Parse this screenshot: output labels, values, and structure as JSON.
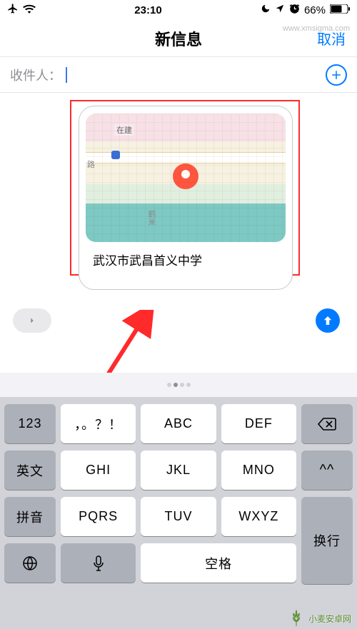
{
  "status": {
    "time": "23:10",
    "battery_pct": "66%"
  },
  "nav": {
    "title": "新信息",
    "cancel": "取消"
  },
  "recipient": {
    "label": "收件人：",
    "value": ""
  },
  "message": {
    "location_title": "武汉市武昌首义中学",
    "map_labels": {
      "under_construction": "在建",
      "road_suffix": "路",
      "vertical": "鹤米"
    }
  },
  "keyboard": {
    "rows": [
      [
        "123",
        "，。？！",
        "ABC",
        "DEF"
      ],
      [
        "英文",
        "GHI",
        "JKL",
        "MNO",
        "^^"
      ],
      [
        "拼音",
        "PQRS",
        "TUV",
        "WXYZ"
      ]
    ],
    "space": "空格",
    "return": "换行"
  },
  "watermark": {
    "site": "小麦安卓网",
    "url": "www.xmsigma.com"
  }
}
